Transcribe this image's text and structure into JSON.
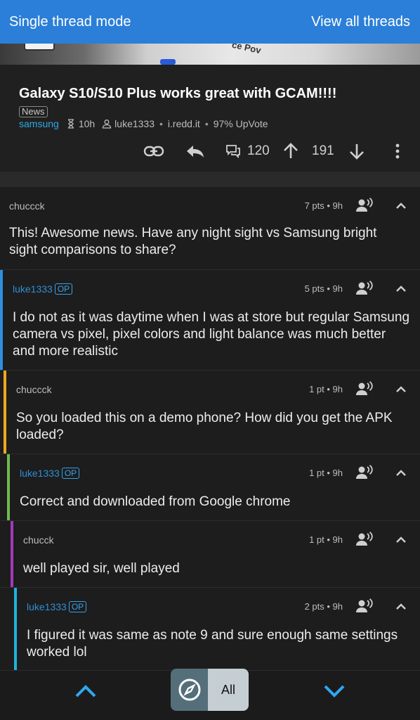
{
  "topbar": {
    "left_label": "Single thread mode",
    "right_label": "View all threads"
  },
  "hero": {
    "text": "ce Pov"
  },
  "post": {
    "title": "Galaxy S10/S10 Plus works great with GCAM!!!!",
    "flair": "News",
    "subreddit": "samsung",
    "age": "10h",
    "author": "luke1333",
    "domain": "i.redd.it",
    "upvote": "97% UpVote",
    "comment_count": "120",
    "score": "191"
  },
  "comments": [
    {
      "author": "chuccck",
      "op": false,
      "meta": "7 pts • 9h",
      "body": "This! Awesome news. Have any night sight vs Samsung bright sight comparisons to share?"
    },
    {
      "author": "luke1333",
      "op": true,
      "meta": "5 pts • 9h",
      "body": "I do not as it was daytime when I was at store but regular Samsung camera vs pixel, pixel colors and light balance was much better and more realistic"
    },
    {
      "author": "chuccck",
      "op": false,
      "meta": "1 pt • 9h",
      "body": "So you loaded this on a demo phone? How did you get the APK loaded?"
    },
    {
      "author": "luke1333",
      "op": true,
      "meta": "1 pt • 9h",
      "body": "Correct and downloaded from Google chrome"
    },
    {
      "author": "chucck",
      "op": false,
      "meta": "1 pt • 9h",
      "body": "well played sir, well played"
    },
    {
      "author": "luke1333",
      "op": true,
      "meta": "2 pts • 9h",
      "body": "I figured it was same as note 9 and sure enough same settings worked lol"
    }
  ],
  "op_badge": "OP",
  "bottom": {
    "filter_label": "All"
  },
  "colors": {
    "accent": "#2b7fd8",
    "depth_bars": [
      "#2f8fe0",
      "#f0a81e",
      "#6dbb4f",
      "#a03ab8",
      "#1fb3d8"
    ]
  }
}
